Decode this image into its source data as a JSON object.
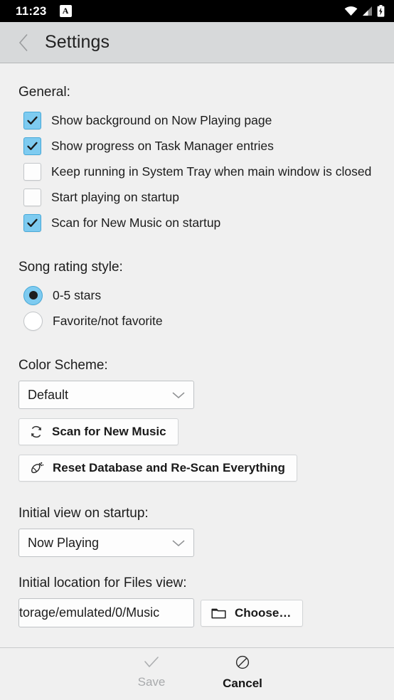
{
  "statusbar": {
    "time": "11:23",
    "app_badge": "A",
    "icons": [
      "wifi-icon",
      "cellular-signal-icon",
      "battery-charging-icon"
    ]
  },
  "header": {
    "title": "Settings",
    "back_icon": "chevron-left-icon"
  },
  "general": {
    "label": "General:",
    "options": [
      {
        "label": "Show background on Now Playing page",
        "checked": true
      },
      {
        "label": "Show progress on Task Manager entries",
        "checked": true
      },
      {
        "label": "Keep running in System Tray when main window is closed",
        "checked": false
      },
      {
        "label": "Start playing on startup",
        "checked": false
      },
      {
        "label": "Scan for New Music on startup",
        "checked": true
      }
    ]
  },
  "rating": {
    "label": "Song rating style:",
    "options": [
      {
        "label": "0-5 stars",
        "selected": true
      },
      {
        "label": "Favorite/not favorite",
        "selected": false
      }
    ]
  },
  "color_scheme": {
    "label": "Color Scheme:",
    "value": "Default",
    "chevron_icon": "chevron-down-icon"
  },
  "actions": {
    "scan": {
      "label": "Scan for New Music",
      "icon": "refresh-icon"
    },
    "reset": {
      "label": "Reset Database and Re-Scan Everything",
      "icon": "broom-icon"
    }
  },
  "initial_view": {
    "label": "Initial view on startup:",
    "value": "Now Playing",
    "chevron_icon": "chevron-down-icon"
  },
  "files_location": {
    "label": "Initial location for Files view:",
    "value": "torage/emulated/0/Music",
    "choose_label": "Choose…",
    "choose_icon": "folder-icon"
  },
  "footer": {
    "save": {
      "label": "Save",
      "icon": "check-icon",
      "enabled": false
    },
    "cancel": {
      "label": "Cancel",
      "icon": "prohibition-icon",
      "enabled": true
    }
  },
  "colors": {
    "accent": "#7ecbf0",
    "accent_border": "#45a8d8",
    "background": "#f0f0f0",
    "header": "#d7d9da",
    "statusbar": "#000000"
  }
}
